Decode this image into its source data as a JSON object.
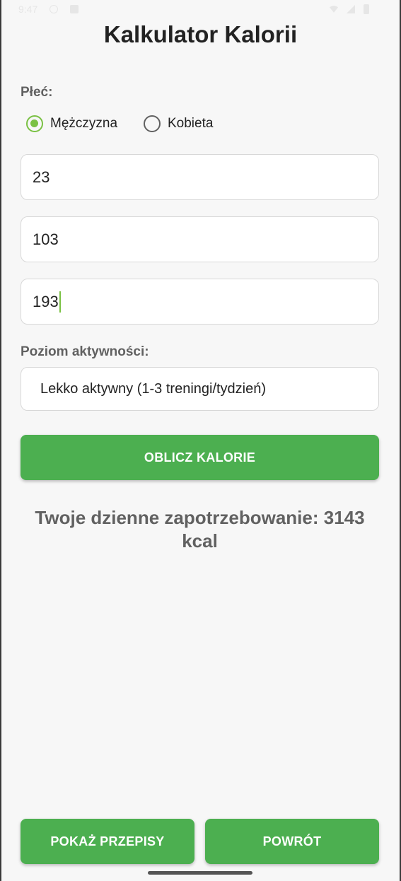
{
  "status_bar": {
    "time": "9:47",
    "icons": [
      "do-not-disturb-icon",
      "app-notification-icon",
      "wifi-icon",
      "signal-icon",
      "battery-icon"
    ]
  },
  "title": "Kalkulator Kalorii",
  "gender": {
    "label": "Płeć:",
    "options": [
      {
        "label": "Mężczyzna",
        "selected": true
      },
      {
        "label": "Kobieta",
        "selected": false
      }
    ]
  },
  "inputs": {
    "age": "23",
    "weight": "103",
    "height": "193"
  },
  "activity": {
    "label": "Poziom aktywności:",
    "selected": "Lekko aktywny (1-3 treningi/tydzień)"
  },
  "calculate_button": "OBLICZ KALORIE",
  "result": "Twoje dzienne zapotrzebowanie: 3143 kcal",
  "bottom_buttons": {
    "recipes": "POKAŻ PRZEPISY",
    "back": "POWRÓT"
  },
  "colors": {
    "accent_green": "#4caf50",
    "radio_green": "#7ac143",
    "label_gray": "#616161"
  }
}
